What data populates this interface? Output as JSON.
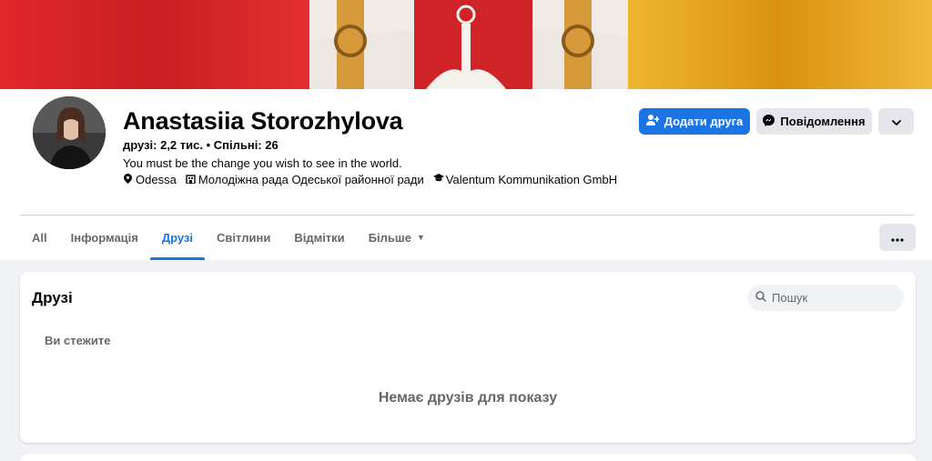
{
  "profile": {
    "name": "Anastasiia Storozhylova",
    "stats": "друзі: 2,2 тис. • Спільні: 26",
    "bio": "You must be the change you wish to see in the world.",
    "facts": [
      {
        "icon": "location-pin-icon",
        "text": "Odessa"
      },
      {
        "icon": "workplace-icon",
        "text": "Молодіжна рада Одеської районної ради"
      },
      {
        "icon": "education-cap-icon",
        "text": "Valentum Kommunikation GmbH"
      }
    ]
  },
  "actions": {
    "add_friend_label": "Додати друга",
    "message_label": "Повідомлення"
  },
  "tabs": [
    {
      "label": "All"
    },
    {
      "label": "Інформація"
    },
    {
      "label": "Друзі",
      "active": true
    },
    {
      "label": "Світлини"
    },
    {
      "label": "Відмітки"
    },
    {
      "label": "Більше"
    }
  ],
  "friends_section": {
    "title": "Друзі",
    "search_placeholder": "Пошук",
    "subtab": "Ви стежите",
    "empty_message": "Немає друзів для показу"
  },
  "colors": {
    "accent": "#1b74e4",
    "cover_red": "#d8262a",
    "cover_gold": "#e8a51a"
  }
}
